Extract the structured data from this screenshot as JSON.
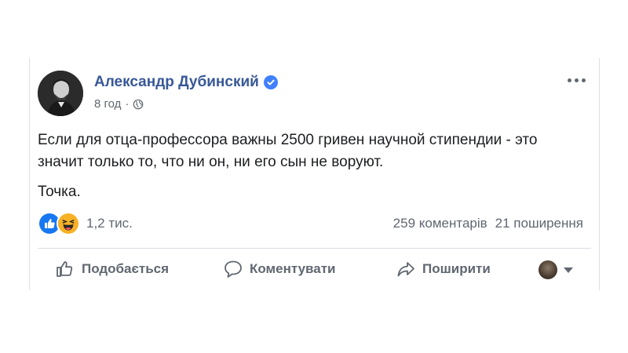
{
  "post": {
    "author": "Александр Дубинский",
    "time": "8 год",
    "separator": "·",
    "text_lines": [
      "Если для отца-профессора важны 2500 гривен научной стипендии - это значит только то, что ни он, ни его сын не воруют.",
      "Точка."
    ],
    "reaction_count": "1,2 тис.",
    "comments": "259 коментарів",
    "shares": "21 поширення"
  },
  "actions": {
    "like": "Подобається",
    "comment": "Коментувати",
    "share": "Поширити"
  },
  "icons": {
    "verified": "verified-badge-icon",
    "audience": "globe-icon",
    "more": "more-options-icon",
    "like_reaction": "like-reaction-icon",
    "haha_reaction": "haha-reaction-icon",
    "like_action": "thumbs-up-icon",
    "comment_action": "comment-bubble-icon",
    "share_action": "share-arrow-icon"
  },
  "colors": {
    "author_link": "#385898",
    "secondary_text": "#606770",
    "verified": "#4080ff",
    "like_blue": "#1877f2",
    "haha_yellow": "#f7b125"
  }
}
